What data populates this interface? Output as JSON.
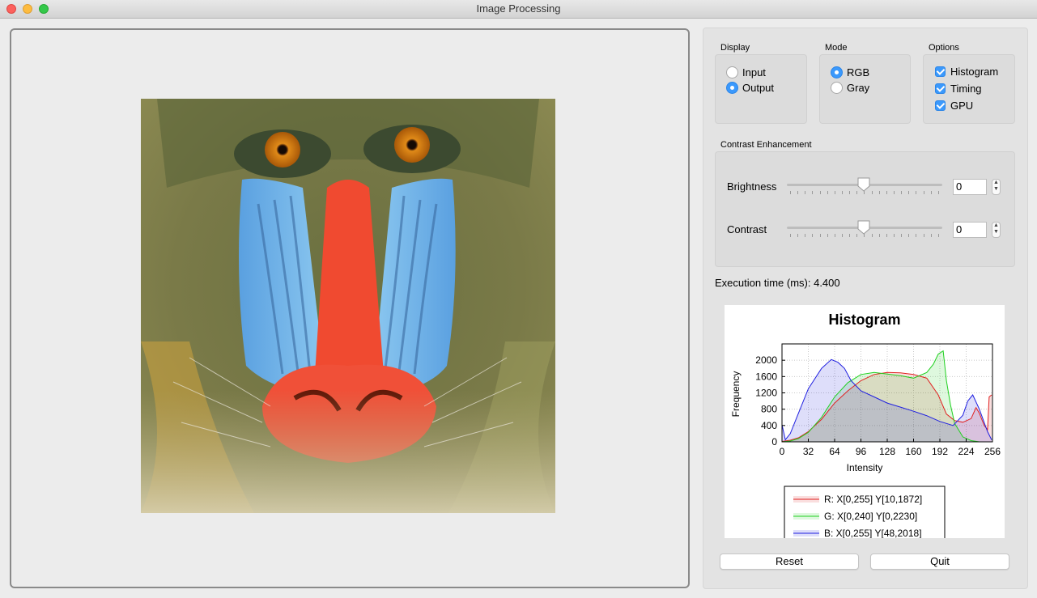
{
  "window": {
    "title": "Image Processing"
  },
  "display": {
    "label": "Display",
    "options": [
      {
        "label": "Input",
        "selected": false
      },
      {
        "label": "Output",
        "selected": true
      }
    ]
  },
  "mode": {
    "label": "Mode",
    "options": [
      {
        "label": "RGB",
        "selected": true
      },
      {
        "label": "Gray",
        "selected": false
      }
    ]
  },
  "options": {
    "label": "Options",
    "items": [
      {
        "label": "Histogram",
        "checked": true
      },
      {
        "label": "Timing",
        "checked": true
      },
      {
        "label": "GPU",
        "checked": true
      }
    ]
  },
  "contrast": {
    "label": "Contrast Enhancement",
    "brightness": {
      "label": "Brightness",
      "value": "0"
    },
    "contrast": {
      "label": "Contrast",
      "value": "0"
    }
  },
  "execution": {
    "label": "Execution time (ms): 4.400"
  },
  "histogram": {
    "title": "Histogram",
    "xlabel": "Intensity",
    "ylabel": "Frequency",
    "xticks": [
      "0",
      "32",
      "64",
      "96",
      "128",
      "160",
      "192",
      "224",
      "256"
    ],
    "yticks": [
      "0",
      "400",
      "800",
      "1200",
      "1600",
      "2000"
    ],
    "legend": [
      {
        "text": "R: X[0,255] Y[10,1872]",
        "color": "#e02020"
      },
      {
        "text": "G: X[0,240] Y[0,2230]",
        "color": "#20d020"
      },
      {
        "text": "B: X[0,255] Y[48,2018]",
        "color": "#2020e0"
      }
    ]
  },
  "chart_data": {
    "type": "area",
    "title": "Histogram",
    "xlabel": "Intensity",
    "ylabel": "Frequency",
    "xlim": [
      0,
      256
    ],
    "ylim": [
      0,
      2400
    ],
    "grid": true,
    "legend_position": "bottom",
    "series": [
      {
        "name": "R: X[0,255] Y[10,1872]",
        "color": "#e02020",
        "x": [
          0,
          10,
          20,
          32,
          48,
          64,
          80,
          96,
          112,
          128,
          144,
          160,
          176,
          190,
          200,
          210,
          220,
          230,
          236,
          240,
          246,
          250,
          252,
          255
        ],
        "y": [
          10,
          40,
          100,
          250,
          550,
          950,
          1250,
          1500,
          1650,
          1700,
          1690,
          1650,
          1560,
          1150,
          680,
          520,
          480,
          570,
          840,
          700,
          400,
          300,
          1100,
          1150
        ]
      },
      {
        "name": "G: X[0,240] Y[0,2230]",
        "color": "#20d020",
        "x": [
          0,
          10,
          20,
          32,
          48,
          64,
          80,
          96,
          112,
          128,
          144,
          160,
          176,
          184,
          190,
          196,
          200,
          205,
          210,
          220,
          230,
          240
        ],
        "y": [
          0,
          20,
          80,
          230,
          600,
          1100,
          1450,
          1650,
          1700,
          1660,
          1620,
          1560,
          1700,
          1900,
          2150,
          2230,
          1500,
          900,
          450,
          120,
          30,
          0
        ]
      },
      {
        "name": "B: X[0,255] Y[48,2018]",
        "color": "#2020e0",
        "x": [
          0,
          4,
          10,
          20,
          32,
          48,
          60,
          68,
          76,
          84,
          96,
          112,
          128,
          144,
          160,
          176,
          192,
          208,
          220,
          226,
          232,
          240,
          250,
          255
        ],
        "y": [
          420,
          50,
          200,
          700,
          1300,
          1800,
          2018,
          1950,
          1800,
          1500,
          1250,
          1100,
          950,
          850,
          750,
          640,
          500,
          400,
          650,
          1000,
          1150,
          800,
          250,
          48
        ]
      }
    ]
  },
  "buttons": {
    "reset": "Reset",
    "quit": "Quit"
  }
}
